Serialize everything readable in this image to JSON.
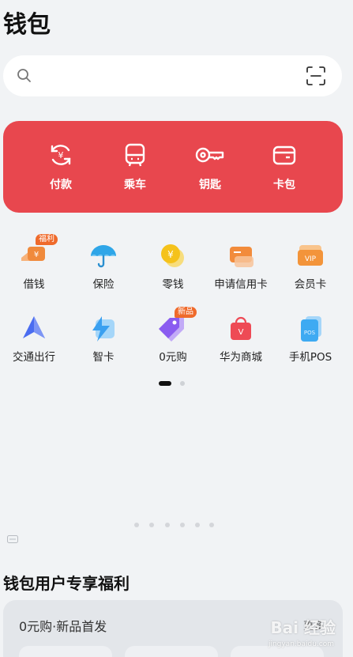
{
  "header": {
    "title": "钱包"
  },
  "search": {
    "icon": "search-icon",
    "scan_icon": "scan-icon"
  },
  "quick_actions": [
    {
      "label": "付款",
      "icon": "payment-icon"
    },
    {
      "label": "乘车",
      "icon": "bus-icon"
    },
    {
      "label": "钥匙",
      "icon": "key-icon"
    },
    {
      "label": "卡包",
      "icon": "card-wallet-icon"
    }
  ],
  "services": [
    {
      "label": "借钱",
      "icon": "loan-icon",
      "badge": "福利",
      "color": "#f08a3c"
    },
    {
      "label": "保险",
      "icon": "umbrella-icon",
      "badge": "",
      "color": "#2fa6e8"
    },
    {
      "label": "零钱",
      "icon": "coin-icon",
      "badge": "",
      "color": "#f5c21b"
    },
    {
      "label": "申请信用卡",
      "icon": "credit-card-icon",
      "badge": "",
      "color": "#f28b3b"
    },
    {
      "label": "会员卡",
      "icon": "vip-card-icon",
      "badge": "",
      "color": "#f3943a"
    },
    {
      "label": "交通出行",
      "icon": "travel-icon",
      "badge": "",
      "color": "#4a6cf0"
    },
    {
      "label": "智卡",
      "icon": "smart-card-icon",
      "badge": "",
      "color": "#3aa0f0"
    },
    {
      "label": "0元购",
      "icon": "tag-icon",
      "badge": "新品",
      "color": "#8a5cf0"
    },
    {
      "label": "华为商城",
      "icon": "shopping-bag-icon",
      "badge": "",
      "color": "#ee4a55"
    },
    {
      "label": "手机POS",
      "icon": "pos-icon",
      "badge": "",
      "color": "#3eaaf2"
    }
  ],
  "welfare": {
    "section_title": "钱包用户专享福利",
    "card_title": "0元购·新品首发",
    "more_label": "更多"
  },
  "watermark": {
    "text": "Bai 经验",
    "sub": "jingyan.baidu.com"
  },
  "colors": {
    "accent_red": "#e8474e",
    "background": "#f1f3f5"
  }
}
